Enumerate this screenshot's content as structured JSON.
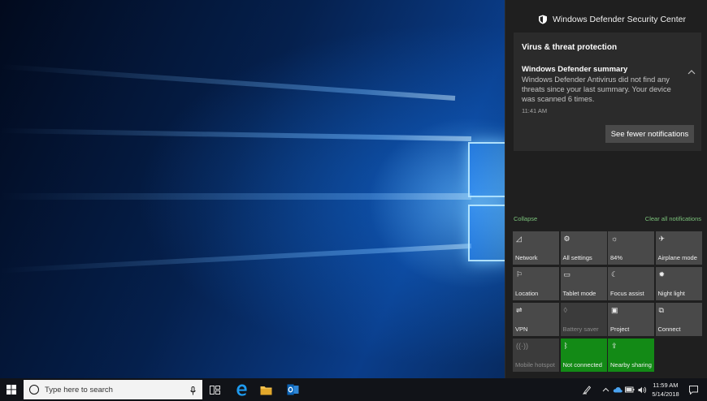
{
  "action_center": {
    "header_title": "Windows Defender Security Center",
    "notification": {
      "group_title": "Virus & threat protection",
      "heading": "Windows Defender summary",
      "body": "Windows Defender Antivirus did not find any threats since your last summary.  Your device was scanned 6 times.",
      "time": "11:41 AM",
      "button_label": "See fewer notifications"
    },
    "collapse_label": "Collapse",
    "clear_all_label": "Clear all notifications",
    "quick_actions": [
      {
        "label": "Network",
        "icon": "network-icon",
        "glyph": "◿",
        "state": "normal"
      },
      {
        "label": "All settings",
        "icon": "settings-gear-icon",
        "glyph": "⚙",
        "state": "normal"
      },
      {
        "label": "84%",
        "icon": "brightness-icon",
        "glyph": "☼",
        "state": "normal"
      },
      {
        "label": "Airplane mode",
        "icon": "airplane-icon",
        "glyph": "✈",
        "state": "normal"
      },
      {
        "label": "Location",
        "icon": "location-icon",
        "glyph": "⚐",
        "state": "normal"
      },
      {
        "label": "Tablet mode",
        "icon": "tablet-mode-icon",
        "glyph": "▭",
        "state": "normal"
      },
      {
        "label": "Focus assist",
        "icon": "moon-icon",
        "glyph": "☾",
        "state": "normal"
      },
      {
        "label": "Night light",
        "icon": "night-light-icon",
        "glyph": "✹",
        "state": "normal"
      },
      {
        "label": "VPN",
        "icon": "vpn-icon",
        "glyph": "⇌",
        "state": "normal"
      },
      {
        "label": "Battery saver",
        "icon": "battery-saver-icon",
        "glyph": "◊",
        "state": "off"
      },
      {
        "label": "Project",
        "icon": "project-icon",
        "glyph": "▣",
        "state": "normal"
      },
      {
        "label": "Connect",
        "icon": "connect-icon",
        "glyph": "⧉",
        "state": "normal"
      },
      {
        "label": "Mobile hotspot",
        "icon": "hotspot-icon",
        "glyph": "((·))",
        "state": "off"
      },
      {
        "label": "Not connected",
        "icon": "bluetooth-icon",
        "glyph": "ᛒ",
        "state": "on"
      },
      {
        "label": "Nearby sharing",
        "icon": "nearby-sharing-icon",
        "glyph": "⇪",
        "state": "on"
      }
    ]
  },
  "taskbar": {
    "search_placeholder": "Type here to search",
    "clock_time": "11:59 AM",
    "clock_date": "5/14/2018"
  },
  "colors": {
    "accent_green": "#138a16",
    "action_center_bg": "#1f1f1f",
    "tile_bg": "#494949",
    "link_green": "#7bc27b"
  }
}
